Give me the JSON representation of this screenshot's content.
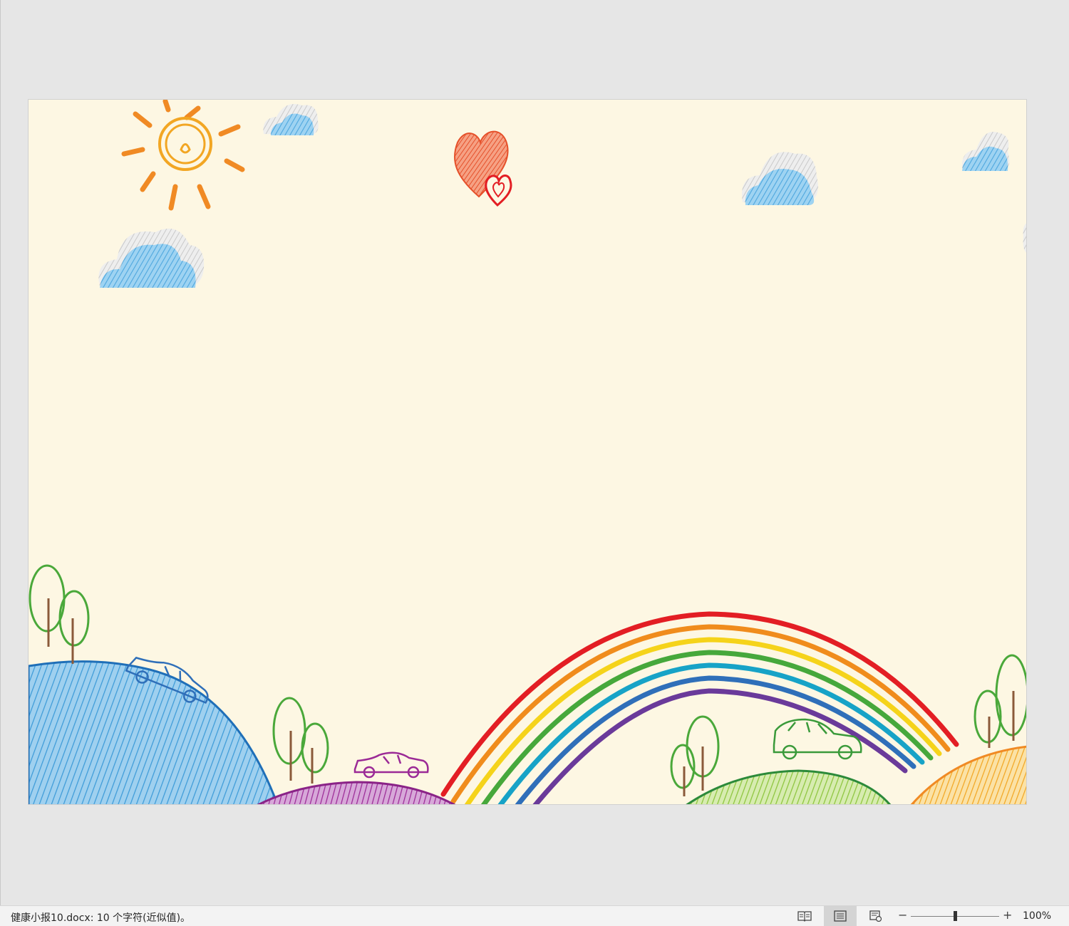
{
  "document": {
    "filename": "健康小报10.docx",
    "status_text": "健康小报10.docx: 10 个字符(近似值)。"
  },
  "statusbar": {
    "views": [
      {
        "name": "read-mode",
        "icon": "book-icon",
        "active": false
      },
      {
        "name": "print-layout",
        "icon": "page-lines-icon",
        "active": true
      },
      {
        "name": "web-layout",
        "icon": "web-page-icon",
        "active": false
      }
    ],
    "zoom_minus": "−",
    "zoom_plus": "+",
    "zoom_level": "100%",
    "zoom_fraction": 0.5
  },
  "colors": {
    "page_background": "#fdf7e3",
    "workspace": "#e6e6e6",
    "rainbow": [
      "#e31e24",
      "#f08c1c",
      "#f5d31a",
      "#46a83b",
      "#17a3c7",
      "#2f6fb9",
      "#6a3a9a"
    ],
    "sky_cloud": "#5bb0e0",
    "sun": "#f2a623"
  },
  "illustration": {
    "elements": [
      "sun-icon",
      "cloud-icon",
      "heart-icon",
      "rainbow",
      "hill",
      "tree-icon",
      "car-icon"
    ]
  }
}
